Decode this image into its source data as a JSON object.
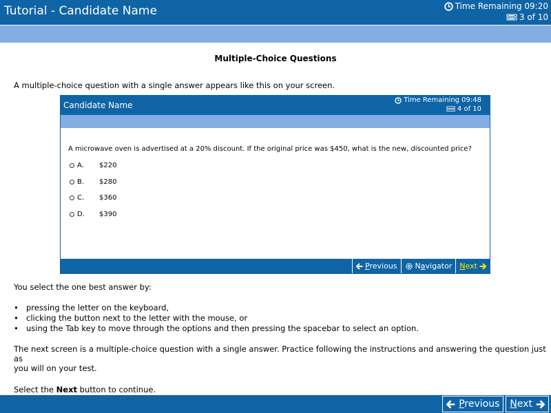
{
  "header": {
    "title": "Tutorial - Candidate Name",
    "time_remaining": "Time Remaining 09:20",
    "progress": "3 of 10"
  },
  "content": {
    "heading": "Multiple-Choice Questions",
    "intro": "A multiple-choice question with a single answer appears like this on your screen.",
    "select_intro": "You select the one best answer by:",
    "bullets": [
      "pressing the letter on the keyboard,",
      "clicking the button next to the letter with the mouse, or",
      "using the Tab key to move through the options and then pressing the spacebar to select an option."
    ],
    "next_screen_line1": "The next screen is a multiple-choice question with a single answer.  Practice following the instructions and answering the question just as",
    "next_screen_line2": "you will on your test.",
    "continue_pre": "Select the ",
    "continue_bold": "Next",
    "continue_post": " button to continue."
  },
  "sample": {
    "title": "Candidate Name",
    "time_remaining": "Time Remaining 09:48",
    "progress": "4 of 10",
    "question": "A microwave oven is advertised at a 20% discount.  If the original price was $450, what is the new, discounted price?",
    "options": [
      {
        "letter": "A.",
        "value": "$220"
      },
      {
        "letter": "B.",
        "value": "$280"
      },
      {
        "letter": "C.",
        "value": "$360"
      },
      {
        "letter": "D.",
        "value": "$390"
      }
    ],
    "footer": {
      "previous_first": "P",
      "previous_rest": "revious",
      "navigator_pre": "N",
      "navigator_u": "a",
      "navigator_rest": "vigator",
      "next_first": "N",
      "next_rest": "ext"
    }
  },
  "footer": {
    "previous_first": "P",
    "previous_rest": "revious",
    "next_first": "N",
    "next_rest": "ext"
  },
  "colors": {
    "header_blue": "#0f64a6",
    "band_blue": "#82aee3",
    "next_yellow": "#ffea00"
  }
}
